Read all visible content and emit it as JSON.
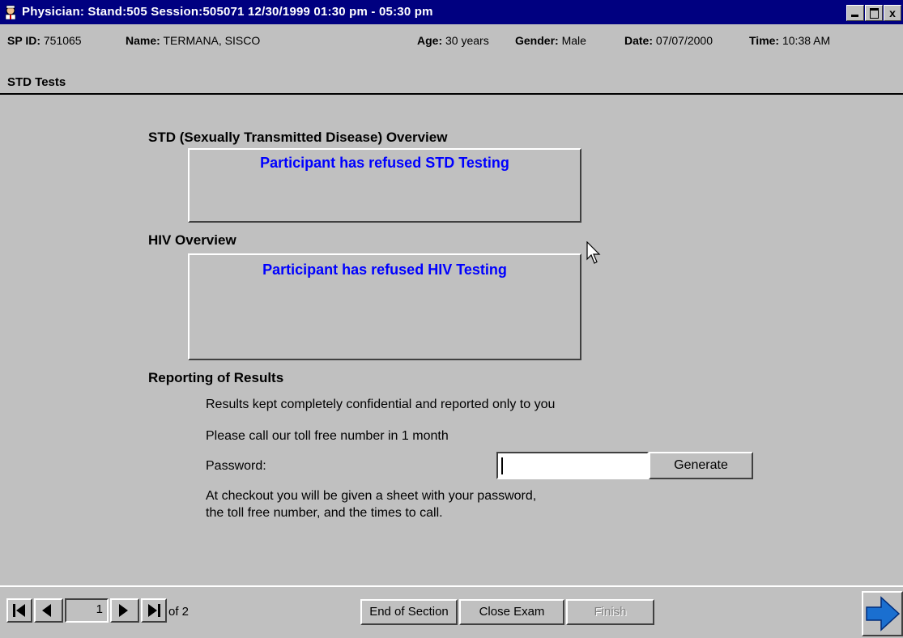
{
  "window": {
    "title": "Physician: Stand:505 Session:505071 12/30/1999 01:30 pm - 05:30 pm",
    "controls": {
      "minimize": "",
      "maximize": "",
      "close": "x"
    }
  },
  "patient": {
    "sp_id_label": "SP ID:",
    "sp_id": "751065",
    "name_label": "Name:",
    "name": "TERMANA, SISCO",
    "age_label": "Age:",
    "age": "30 years",
    "gender_label": "Gender:",
    "gender": "Male",
    "date_label": "Date:",
    "date": "07/07/2000",
    "time_label": "Time:",
    "time": "10:38 AM"
  },
  "section_title": "STD Tests",
  "std": {
    "heading": "STD (Sexually Transmitted Disease) Overview",
    "message": "Participant has refused STD Testing"
  },
  "hiv": {
    "heading": "HIV Overview",
    "message": "Participant has refused HIV Testing"
  },
  "reporting": {
    "heading": "Reporting of Results",
    "line1": "Results kept completely confidential and reported only to you",
    "line2": "Please call our toll free number in 1 month",
    "password_label": "Password:",
    "password_value": "",
    "generate_label": "Generate",
    "note_line1": "At checkout you will be given a sheet with your password,",
    "note_line2": "the toll free number, and the times to call."
  },
  "navigation": {
    "current_page": "1",
    "of_label": "of 2"
  },
  "footer": {
    "end_of_section": "End of Section",
    "close_exam": "Close Exam",
    "finish": "Finish"
  }
}
